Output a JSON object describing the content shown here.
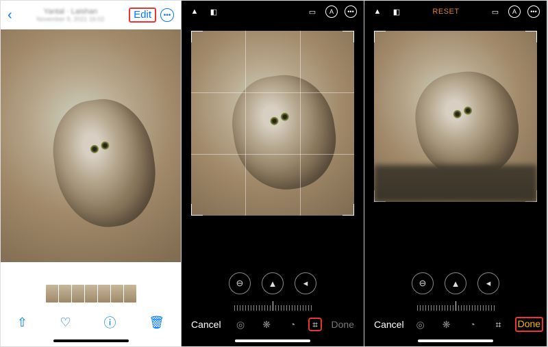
{
  "pane1": {
    "header": {
      "title": "Yantal · Laishan",
      "subtitle": "November 9, 2021  16:02",
      "edit_label": "Edit"
    },
    "toolbar": {
      "share": "share-icon",
      "heart": "heart-icon",
      "info": "info-icon",
      "trash": "trash-icon"
    }
  },
  "pane2": {
    "bottom": {
      "cancel_label": "Cancel",
      "done_label": "Done"
    }
  },
  "pane3": {
    "header": {
      "reset_label": "RESET"
    },
    "bottom": {
      "cancel_label": "Cancel",
      "done_label": "Done"
    }
  }
}
